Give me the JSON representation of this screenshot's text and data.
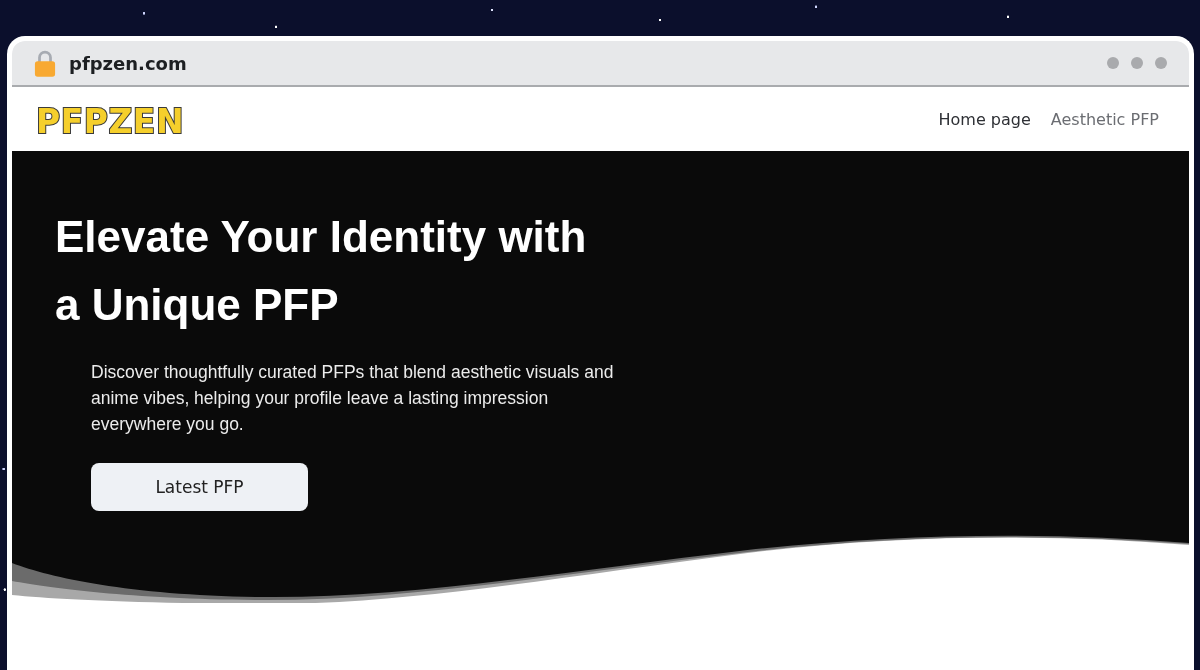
{
  "browser": {
    "url": "pfpzen.com"
  },
  "site": {
    "logo": "PFPZEN",
    "nav": [
      {
        "label": "Home page",
        "selected": true
      },
      {
        "label": "Aesthetic PFP",
        "selected": false
      }
    ]
  },
  "hero": {
    "title": "Elevate Your Identity with a Unique PFP",
    "text": "Discover thoughtfully curated PFPs that blend aesthetic visuals and anime vibes, helping your profile leave a lasting impression everywhere you go.",
    "button": "Latest PFP"
  }
}
